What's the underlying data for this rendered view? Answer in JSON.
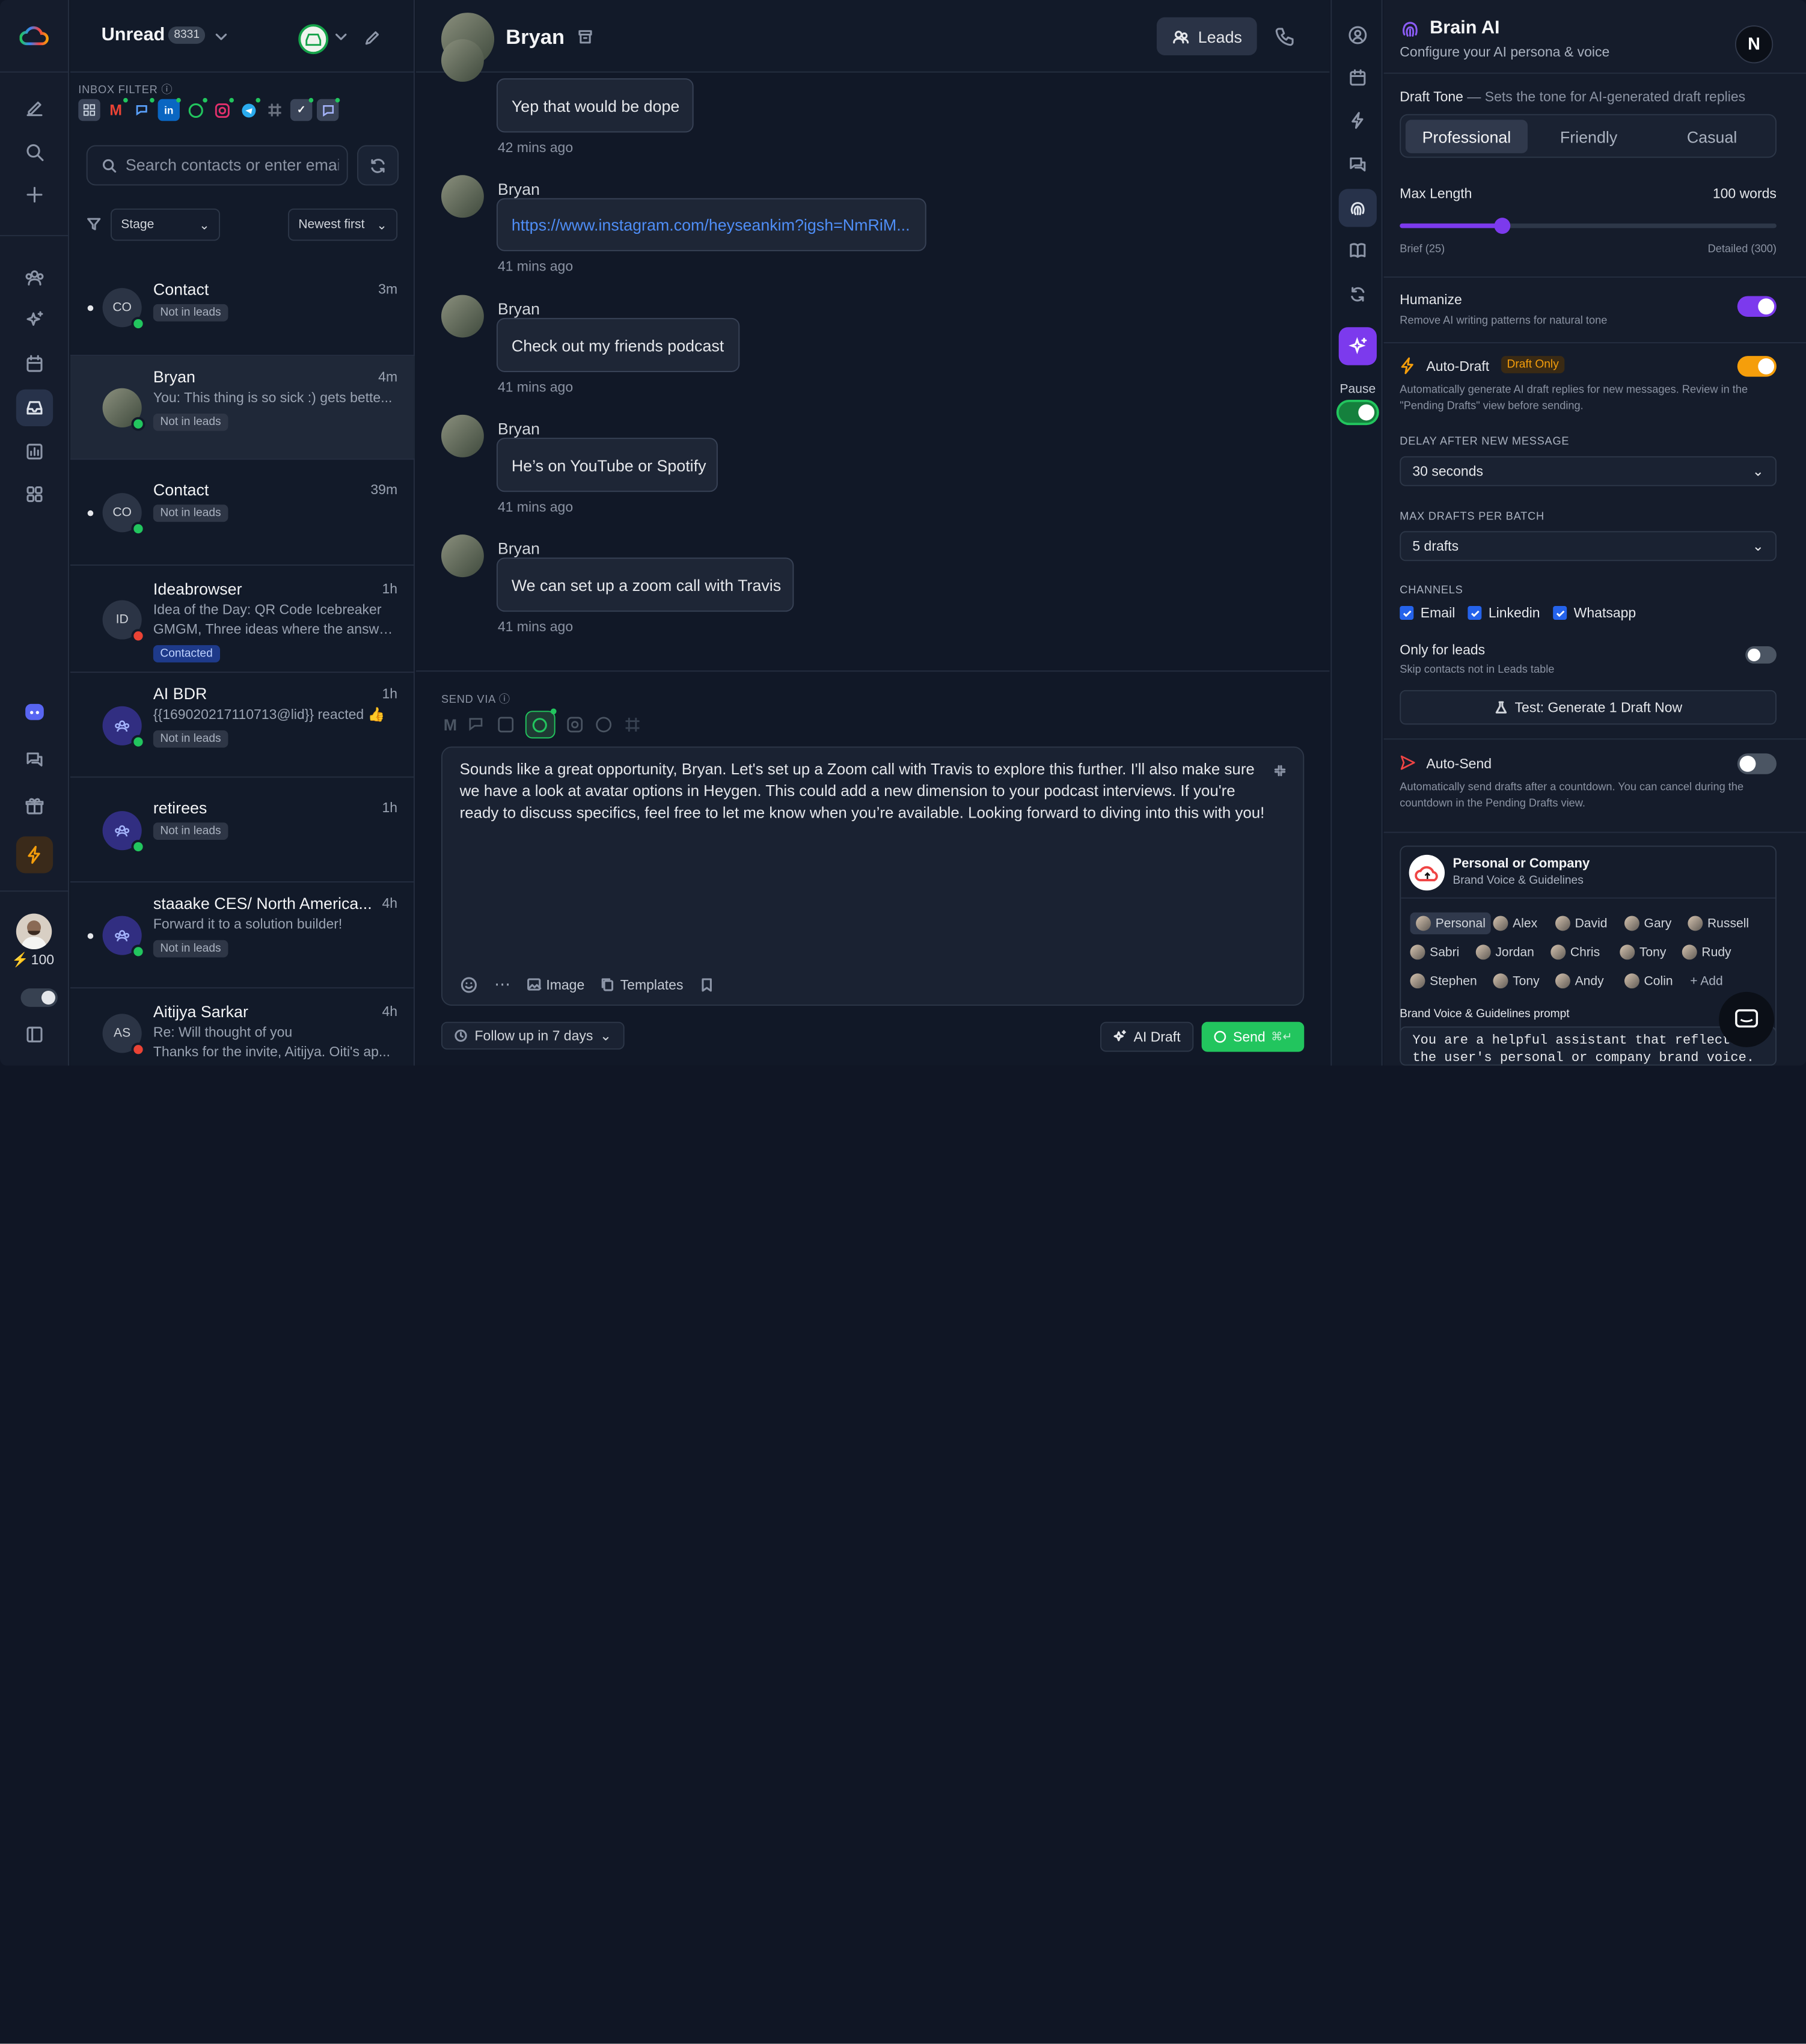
{
  "list": {
    "filter_label": "Unread",
    "unread_count": "8331",
    "inbox_filter_label": "INBOX FILTER",
    "search_placeholder": "Search contacts or enter email",
    "stage_select": "Stage",
    "sort_select": "Newest first",
    "rows": [
      {
        "name": "Contact",
        "initials": "CO",
        "time": "3m",
        "preview": "",
        "preview2": "",
        "tag": "Not in leads",
        "unread": true,
        "channel": "whatsapp"
      },
      {
        "name": "Bryan",
        "initials": "",
        "time": "4m",
        "preview": "You: This thing is so sick :) gets bette...",
        "preview2": "",
        "tag": "Not in leads",
        "unread": false,
        "channel": "whatsapp"
      },
      {
        "name": "Contact",
        "initials": "CO",
        "time": "39m",
        "preview": "",
        "preview2": "",
        "tag": "Not in leads",
        "unread": true,
        "channel": "whatsapp"
      },
      {
        "name": "Ideabrowser",
        "initials": "ID",
        "time": "1h",
        "preview": "Idea of the Day: QR Code Icebreaker",
        "preview2": "GMGM, Three ideas where the answe...",
        "tag": "Contacted",
        "unread": false,
        "channel": "gmail"
      },
      {
        "name": "AI BDR",
        "initials": "",
        "time": "1h",
        "preview": "{{169020217110713@lid}} reacted 👍",
        "preview2": "",
        "tag": "Not in leads",
        "unread": false,
        "channel": "whatsapp"
      },
      {
        "name": "retirees",
        "initials": "",
        "time": "1h",
        "preview": "",
        "preview2": "",
        "tag": "Not in leads",
        "unread": false,
        "channel": "whatsapp"
      },
      {
        "name": "staaake CES/ North America...",
        "initials": "",
        "time": "4h",
        "preview": "Forward it to a solution builder!",
        "preview2": "",
        "tag": "Not in leads",
        "unread": true,
        "channel": "whatsapp"
      },
      {
        "name": "Aitijya Sarkar",
        "initials": "AS",
        "time": "4h",
        "preview": "Re: Will thought of you",
        "preview2": "Thanks for the invite, Aitijya. Oiti's ap...",
        "tag": "",
        "unread": false,
        "channel": "gmail"
      }
    ]
  },
  "rail": {
    "credits": "100"
  },
  "conversation": {
    "contact_name": "Bryan",
    "leads_button": "Leads",
    "messages": [
      {
        "sender": "",
        "text": "Yep that would be dope",
        "time": "42 mins ago",
        "link": false
      },
      {
        "sender": "Bryan",
        "text": "https://www.instagram.com/heyseankim?igsh=NmRiM...",
        "time": "41 mins ago",
        "link": true
      },
      {
        "sender": "Bryan",
        "text": "Check out my friends podcast",
        "time": "41 mins ago",
        "link": false
      },
      {
        "sender": "Bryan",
        "text": "He’s on YouTube or Spotify",
        "time": "41 mins ago",
        "link": false
      },
      {
        "sender": "Bryan",
        "text": "We can set up a zoom call with Travis",
        "time": "41 mins ago",
        "link": false
      }
    ],
    "send_via_label": "SEND VIA",
    "draft_text": "Sounds like a great opportunity, Bryan. Let's set up a Zoom call with Travis to explore this further. I'll also make sure we have a look at avatar options in Heygen. This could add a new dimension to your podcast interviews. If you're ready to discuss specifics, feel free to let me know when you’re available. Looking forward to diving into this with you!",
    "image_label": "Image",
    "templates_label": "Templates",
    "follow_up": "Follow up in 7 days",
    "ai_draft": "AI Draft",
    "send": "Send",
    "send_shortcut": "⌘↵"
  },
  "strip": {
    "pause_label": "Pause"
  },
  "brain": {
    "title": "Brain AI",
    "subtitle": "Configure your AI persona & voice",
    "avatar_letter": "N",
    "draft_tone_label": "Draft Tone",
    "draft_tone_hint": "— Sets the tone for AI-generated draft replies",
    "tones": [
      "Professional",
      "Friendly",
      "Casual"
    ],
    "selected_tone": "Professional",
    "max_length_label": "Max Length",
    "max_length_value": "100 words",
    "max_length_words": 100,
    "max_length_min": 25,
    "max_length_max": 300,
    "brief_label": "Brief (25)",
    "detailed_label": "Detailed (300)",
    "humanize_label": "Humanize",
    "humanize_desc": "Remove AI writing patterns for natural tone",
    "humanize_on": true,
    "auto_draft_label": "Auto-Draft",
    "auto_draft_badge": "Draft Only",
    "auto_draft_desc1": "Automatically generate AI draft replies for new messages. Review in the",
    "auto_draft_desc2": "\"Pending Drafts\" view before sending.",
    "auto_draft_on": true,
    "delay_label": "DELAY AFTER NEW MESSAGE",
    "delay_value": "30 seconds",
    "max_drafts_label": "MAX DRAFTS PER BATCH",
    "max_drafts_value": "5 drafts",
    "channels_label": "CHANNELS",
    "channels": [
      "Email",
      "Linkedin",
      "Whatsapp"
    ],
    "only_leads_label": "Only for leads",
    "only_leads_desc": "Skip contacts not in Leads table",
    "only_leads_on": false,
    "test_button": "Test: Generate 1 Draft Now",
    "auto_send_label": "Auto-Send",
    "auto_send_desc1": "Automatically send drafts after a countdown. You can cancel during the",
    "auto_send_desc2": "countdown in the Pending Drafts view.",
    "auto_send_on": false,
    "persona_title": "Personal or Company",
    "persona_sub": "Brand Voice & Guidelines",
    "personas": [
      [
        "Personal",
        "Alex",
        "David",
        "Gary",
        "Russell"
      ],
      [
        "Sabri",
        "Jordan",
        "Chris",
        "Tony",
        "Rudy"
      ],
      [
        "Stephen",
        "Tony",
        "Andy",
        "Colin",
        "+ Add"
      ]
    ],
    "prompt_label": "Brand Voice & Guidelines prompt",
    "prompt_text": "You are a helpful assistant that reflects the user's personal or company brand voice."
  },
  "colors": {
    "accent_purple": "#7c3aed",
    "accent_orange": "#f59e0b",
    "send_green": "#22c55e",
    "link_blue": "#4f8ef7"
  }
}
